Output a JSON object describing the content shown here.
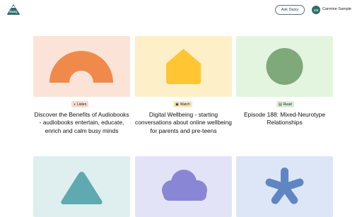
{
  "header": {
    "logo_text": "Daisy",
    "ask_button": "Ask Daisy",
    "avatar_initials": "CS",
    "user_name": "Carmine Sample"
  },
  "cards": [
    {
      "badge": "Listen",
      "badge_icon": "headphones-icon",
      "badge_color": "#f7dccc",
      "thumb_color": "#fbe3d7",
      "shape_color": "#f08a4b",
      "title": "Discover the Benefits of Audiobooks - audiobooks entertain, educate, enrich and calm busy minds"
    },
    {
      "badge": "Watch",
      "badge_icon": "tv-icon",
      "badge_color": "#fbe9bf",
      "thumb_color": "#fdf0c9",
      "shape_color": "#ffc533",
      "title": "Digital Wellbeing - starting conversations about online wellbeing for parents and pre-teens"
    },
    {
      "badge": "Read",
      "badge_icon": "book-icon",
      "badge_color": "#d8efd6",
      "thumb_color": "#e3f5df",
      "shape_color": "#7fa87b",
      "title": "Episode 188: Mixed-Neurotype Relationships"
    },
    {
      "thumb_color": "#dfeeee",
      "shape_color": "#5fa9b0"
    },
    {
      "thumb_color": "#e3e3f8",
      "shape_color": "#8a86d6"
    },
    {
      "thumb_color": "#dde6f6",
      "shape_color": "#5f86c2"
    }
  ]
}
